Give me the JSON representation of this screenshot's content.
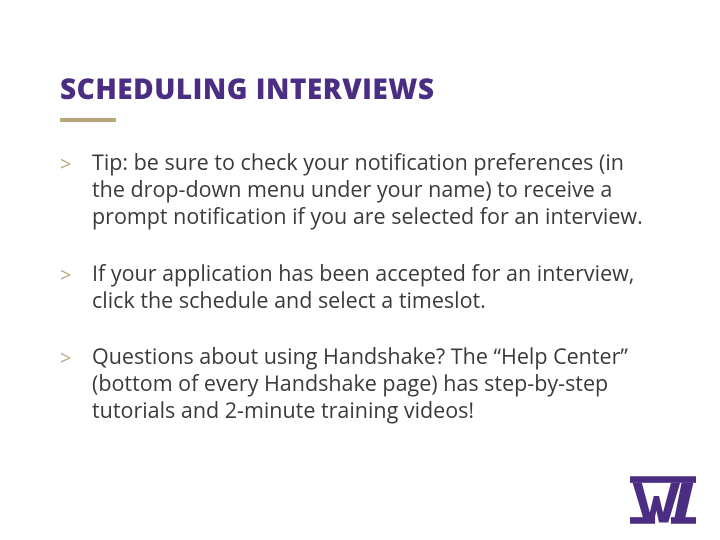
{
  "title": "SCHEDULING INTERVIEWS",
  "bullets": {
    "b1": "Tip: be sure to check your notification preferences (in the drop-down menu under your name) to receive a prompt notification if you are selected for an interview.",
    "b2": "If your application has been accepted for an interview, click the schedule and select a timeslot.",
    "b3": "Questions about using Handshake? The “Help Center” (bottom of every Handshake page) has step-by-step tutorials and 2-minute training videos!"
  },
  "glyph": ">",
  "colors": {
    "brand_purple": "#4b2e83",
    "accent_gold": "#b7a57a"
  }
}
